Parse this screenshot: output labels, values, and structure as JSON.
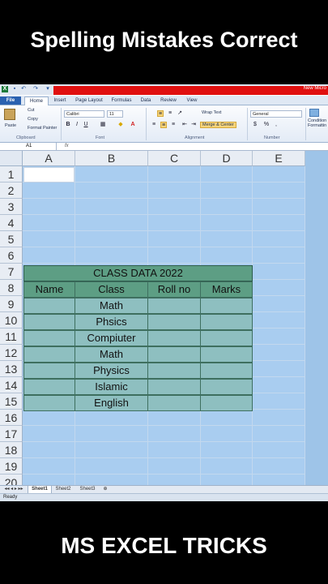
{
  "overlay": {
    "top_title": "Spelling Mistakes Correct",
    "bottom_title": "MS EXCEL TRICKS"
  },
  "window": {
    "title_right": "New Micro"
  },
  "ribbon_tabs": [
    "File",
    "Home",
    "Insert",
    "Page Layout",
    "Formulas",
    "Data",
    "Review",
    "View"
  ],
  "ribbon": {
    "paste": "Paste",
    "cut": "Cut",
    "copy": "Copy",
    "format_painter": "Format Painter",
    "font_name": "Calibri",
    "font_size": "11",
    "bold": "B",
    "italic": "I",
    "underline": "U",
    "wrap_text": "Wrap Text",
    "merge_center": "Merge & Center",
    "number_format": "General",
    "currency": "$",
    "percent": "%",
    "comma": ",",
    "conditional": "Condition Formattin",
    "groups": {
      "clipboard": "Clipboard",
      "font": "Font",
      "alignment": "Alignment",
      "number": "Number"
    }
  },
  "formula_bar": {
    "name_box": "A1",
    "fx": "fx"
  },
  "columns": [
    "A",
    "B",
    "C",
    "D",
    "E"
  ],
  "rows": [
    "1",
    "2",
    "3",
    "4",
    "5",
    "6",
    "7",
    "8",
    "9",
    "10",
    "11",
    "12",
    "13",
    "14",
    "15",
    "16",
    "17",
    "18",
    "19",
    "20"
  ],
  "table": {
    "title": "CLASS DATA 2022",
    "headers": [
      "Name",
      "Class",
      "Roll no",
      "Marks"
    ],
    "classes": [
      "Math",
      "Phsics",
      "Compiuter",
      "Math",
      "Physics",
      "Islamic",
      "English"
    ]
  },
  "sheets": [
    "Sheet1",
    "Sheet2",
    "Sheet3"
  ],
  "status": "Ready"
}
